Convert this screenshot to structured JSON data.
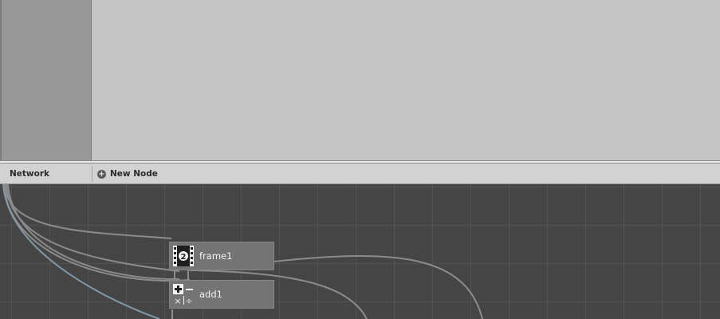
{
  "panel": {
    "title": "Network",
    "new_node_label": "New Node"
  },
  "nodes": [
    {
      "name": "frame1",
      "icon": "film-frame-icon"
    },
    {
      "name": "add1",
      "icon": "math-operators-icon"
    }
  ],
  "colors": {
    "canvas": "#454545",
    "grid": "#525252",
    "node": "#747474",
    "wire": "#8c8c8c",
    "wire_selected": "#7f9aa8"
  }
}
